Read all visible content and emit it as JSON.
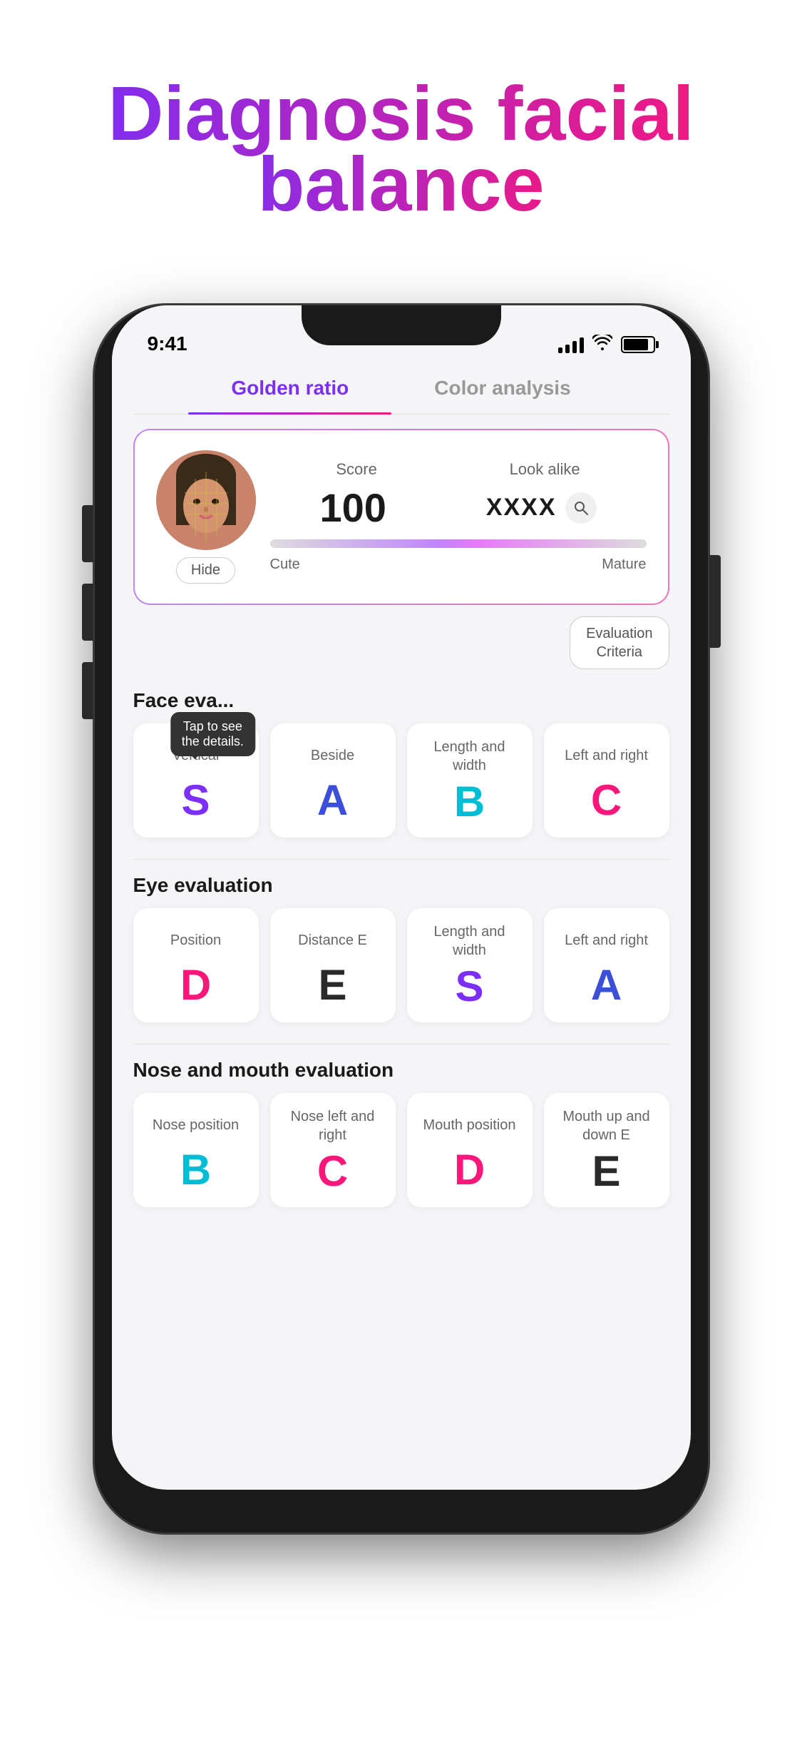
{
  "hero": {
    "title_line1": "Diagnosis facial",
    "title_line2": "balance"
  },
  "status_bar": {
    "time": "9:41",
    "signal": "●●●●",
    "wifi": "WiFi",
    "battery": "Battery"
  },
  "tabs": [
    {
      "id": "golden-ratio",
      "label": "Golden ratio",
      "active": true
    },
    {
      "id": "color-analysis",
      "label": "Color analysis",
      "active": false
    }
  ],
  "score_card": {
    "hide_label": "Hide",
    "score_header": "Score",
    "look_alike_header": "Look alike",
    "score_value": "100",
    "look_alike_value": "XXXX",
    "cute_label": "Cute",
    "mature_label": "Mature"
  },
  "eval_criteria_btn": "Evaluation\nCriteria",
  "tooltip": {
    "line1": "Tap to see",
    "line2": "the details."
  },
  "face_evaluation": {
    "section_label": "Face eva...",
    "cards": [
      {
        "label": "Vertical",
        "grade": "S",
        "color": "grade-purple"
      },
      {
        "label": "Beside",
        "grade": "A",
        "color": "grade-darkblue"
      },
      {
        "label": "Length and width",
        "grade": "B",
        "color": "grade-cyan"
      },
      {
        "label": "Left and right",
        "grade": "C",
        "color": "grade-pink"
      }
    ]
  },
  "eye_evaluation": {
    "section_label": "Eye evaluation",
    "cards": [
      {
        "label": "Position",
        "grade": "D",
        "color": "grade-pink"
      },
      {
        "label": "Distance E",
        "grade": "E",
        "color": "grade-dark"
      },
      {
        "label": "Length and width",
        "grade": "S",
        "color": "grade-purple"
      },
      {
        "label": "Left and right",
        "grade": "A",
        "color": "grade-darkblue"
      }
    ]
  },
  "nose_mouth_evaluation": {
    "section_label": "Nose and mouth evaluation",
    "cards": [
      {
        "label": "Nose position",
        "grade": "B",
        "color": "grade-cyan"
      },
      {
        "label": "Nose left and right",
        "grade": "C",
        "color": "grade-pink"
      },
      {
        "label": "Mouth position",
        "grade": "D",
        "color": "grade-pink"
      },
      {
        "label": "Mouth up and down E",
        "grade": "E",
        "color": "grade-dark"
      }
    ]
  }
}
